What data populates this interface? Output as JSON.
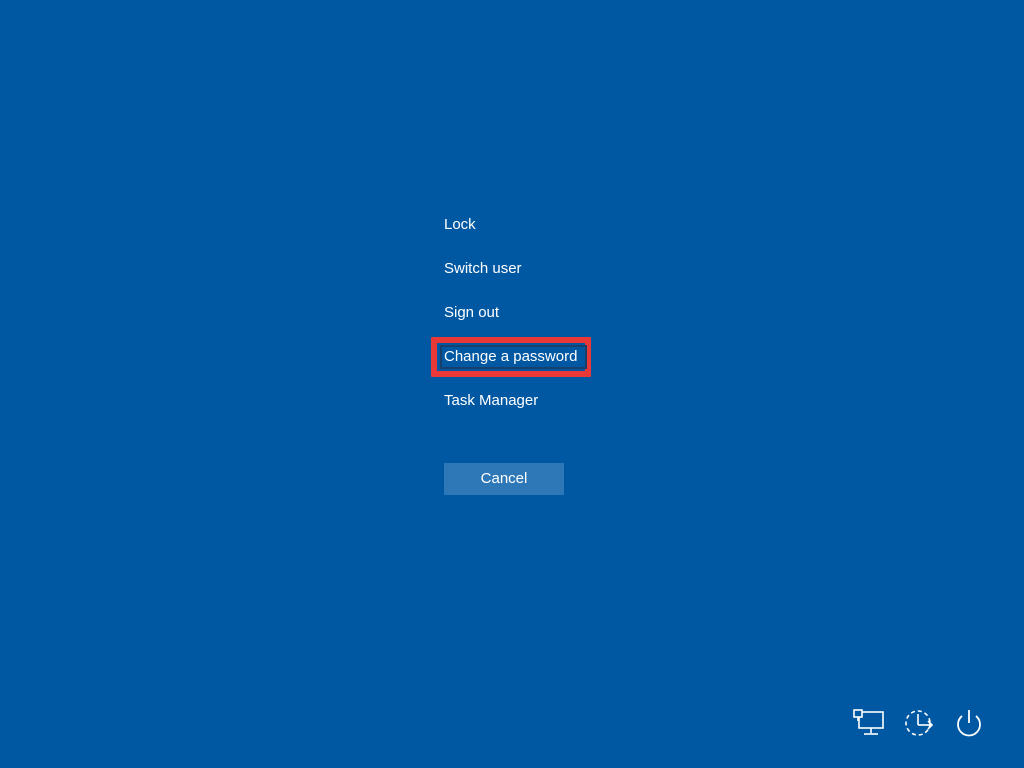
{
  "menu": {
    "items": [
      {
        "label": "Lock"
      },
      {
        "label": "Switch user"
      },
      {
        "label": "Sign out"
      },
      {
        "label": "Change a password"
      },
      {
        "label": "Task Manager"
      }
    ],
    "highlighted_item": "Change a password",
    "highlight_color": "#e83838"
  },
  "cancel": {
    "label": "Cancel"
  },
  "tray": {
    "icons": [
      "network-icon",
      "ease-of-access-icon",
      "power-icon"
    ]
  },
  "colors": {
    "background": "#0058a3",
    "button": "#2f78b8",
    "text": "#ffffff"
  }
}
